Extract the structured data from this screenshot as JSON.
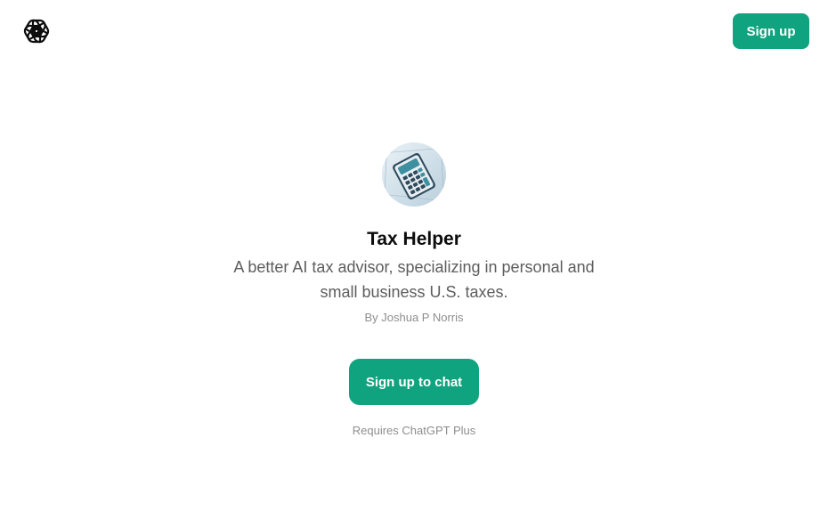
{
  "header": {
    "logo_icon": "openai-logo-icon",
    "signup_label": "Sign up"
  },
  "gpt": {
    "avatar_icon": "calculator-icon",
    "title": "Tax Helper",
    "description": "A better AI tax advisor, specializing in personal and small business U.S. taxes.",
    "author": "By Joshua P Norris"
  },
  "cta": {
    "label": "Sign up to chat",
    "requirement": "Requires ChatGPT Plus"
  },
  "colors": {
    "accent": "#10a37f",
    "text_primary": "#0d0d0d",
    "text_secondary": "#5d5d5d",
    "text_muted": "#8e8e8e"
  }
}
